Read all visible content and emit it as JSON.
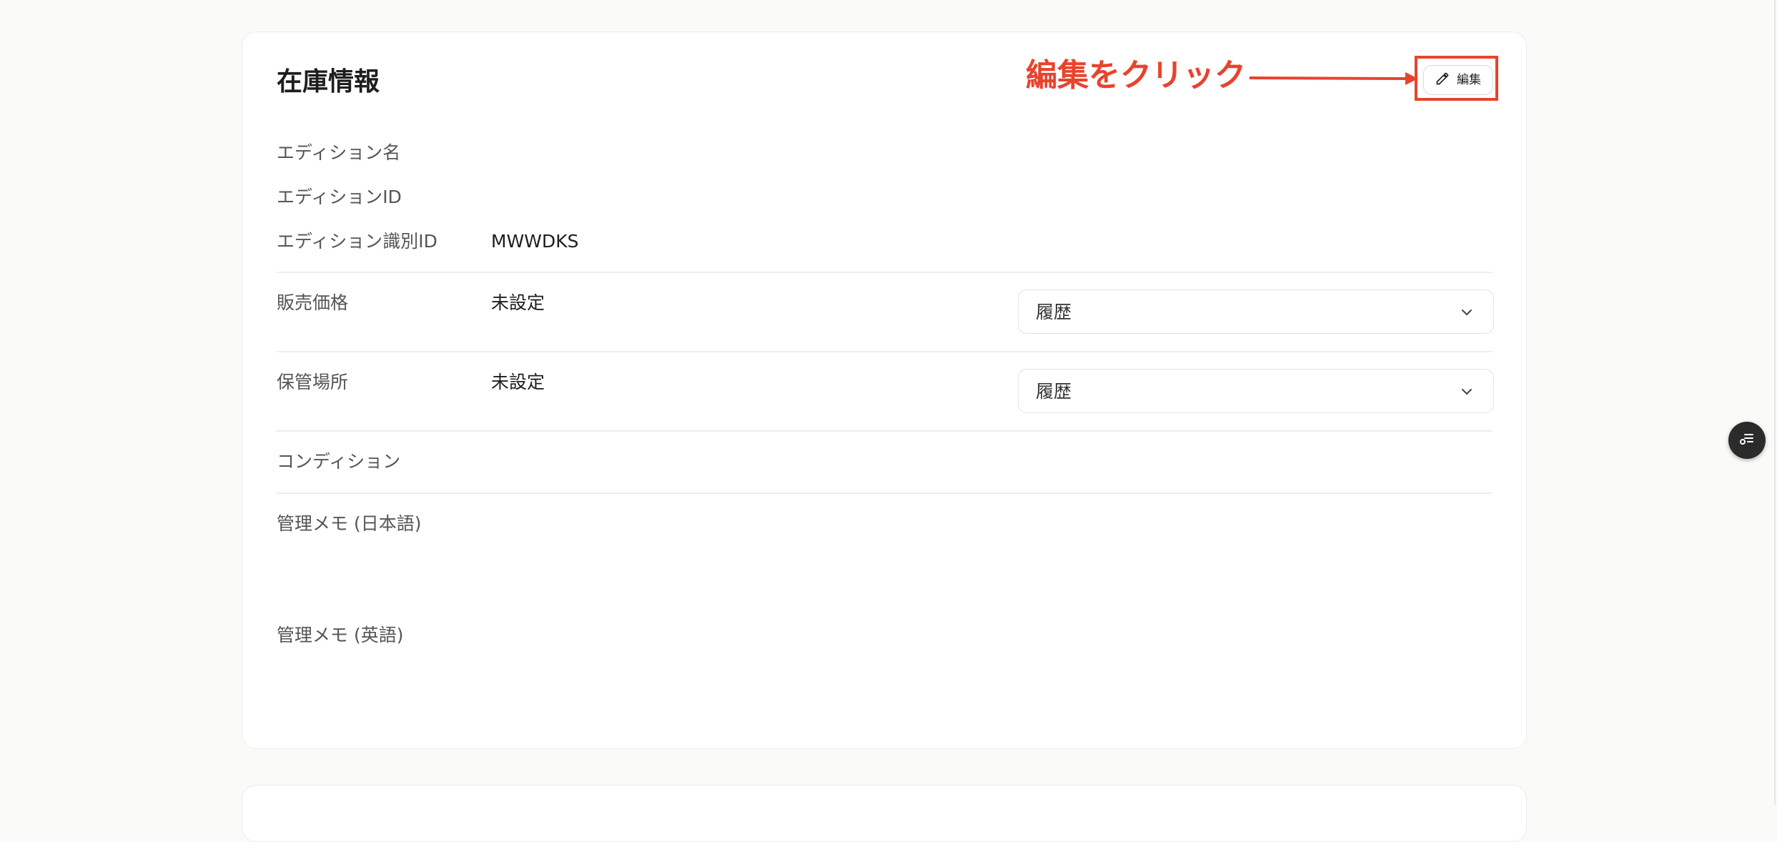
{
  "section": {
    "title": "在庫情報",
    "edit_button_label": "編集"
  },
  "annotation": {
    "text": "編集をクリック",
    "color": "#e8432e"
  },
  "fields": {
    "edition_name": {
      "label": "エディション名",
      "value": ""
    },
    "edition_id": {
      "label": "エディションID",
      "value": ""
    },
    "edition_identifier": {
      "label": "エディション識別ID",
      "value": "MWWDKS"
    },
    "sale_price": {
      "label": "販売価格",
      "value": "未設定",
      "history_label": "履歴"
    },
    "storage_location": {
      "label": "保管場所",
      "value": "未設定",
      "history_label": "履歴"
    },
    "condition": {
      "label": "コンディション",
      "value": ""
    },
    "admin_memo_ja": {
      "label": "管理メモ (日本語)",
      "value": ""
    },
    "admin_memo_en": {
      "label": "管理メモ (英語)",
      "value": ""
    }
  },
  "icons": {
    "edit": "pencil-icon",
    "dropdown": "chevron-down-icon",
    "fab": "checklist-icon"
  }
}
